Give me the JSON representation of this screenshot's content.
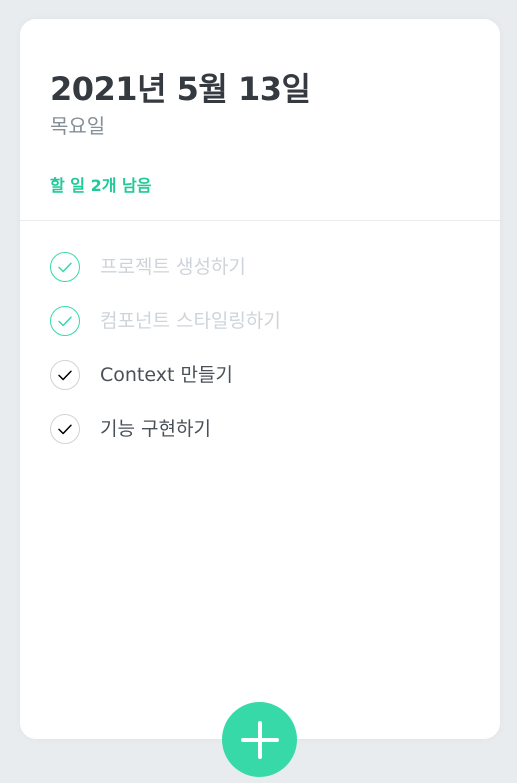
{
  "header": {
    "date": "2021년 5월 13일",
    "day": "목요일",
    "tasks_left": "할 일 2개 남음"
  },
  "todos": [
    {
      "text": "프로젝트 생성하기",
      "done": true
    },
    {
      "text": "컴포넌트 스타일링하기",
      "done": true
    },
    {
      "text": "Context 만들기",
      "done": false
    },
    {
      "text": "기능 구현하기",
      "done": false
    }
  ],
  "icons": {
    "check": "check-icon",
    "add": "plus-icon"
  },
  "colors": {
    "accent": "#38d9a9",
    "tasks_left": "#20c997",
    "background": "#e9ecef",
    "done_text": "#ced4da"
  }
}
